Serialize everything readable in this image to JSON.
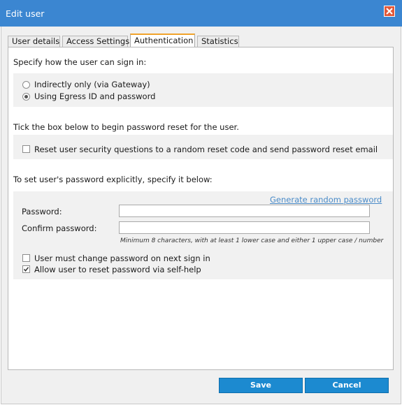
{
  "window": {
    "title": "Edit user",
    "close_icon": "close-icon"
  },
  "tabs": [
    {
      "label": "User details",
      "active": false
    },
    {
      "label": "Access Settings",
      "active": false
    },
    {
      "label": "Authentication",
      "active": true
    },
    {
      "label": "Statistics",
      "active": false
    }
  ],
  "signin": {
    "heading": "Specify how the user can sign in:",
    "options": [
      {
        "label": "Indirectly only (via Gateway)",
        "selected": false
      },
      {
        "label": "Using Egress ID and password",
        "selected": true
      }
    ]
  },
  "reset": {
    "heading": "Tick the box below to begin password reset for the user.",
    "checkbox_label": "Reset user security questions to a random reset code and send password reset email",
    "checked": false
  },
  "password": {
    "heading": "To set user's password explicitly, specify it below:",
    "generate_link": "Generate random password",
    "password_label": "Password:",
    "password_value": "",
    "confirm_label": "Confirm password:",
    "confirm_value": "",
    "hint": "Minimum 8 characters, with at least 1 lower case and either 1 upper case / number",
    "must_change_label": "User must change password on next sign in",
    "must_change_checked": false,
    "self_help_label": "Allow user to reset password via self-help",
    "self_help_checked": true
  },
  "buttons": {
    "save": "Save",
    "cancel": "Cancel"
  },
  "colors": {
    "titlebar": "#3b86d1",
    "tab_accent": "#f0a32a",
    "button": "#1c8ad0",
    "link": "#4a8bc8"
  }
}
